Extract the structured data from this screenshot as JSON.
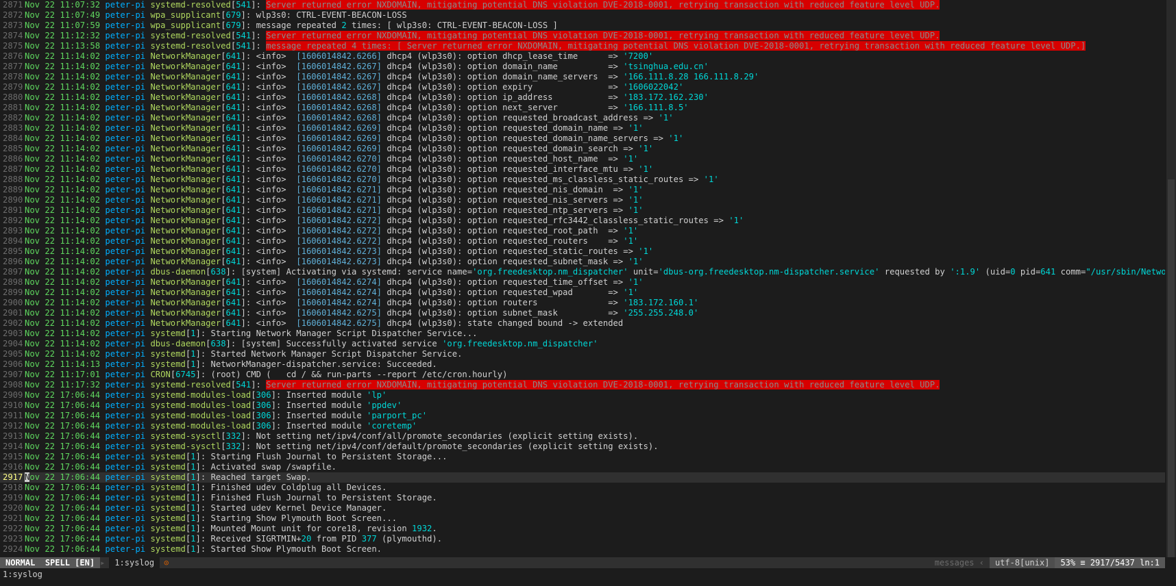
{
  "lines": [
    {
      "n": "2871",
      "ts": "Nov 22 11:07:32",
      "host": "peter-pi",
      "prog": "systemd-resolved",
      "pid": "541",
      "msg": "Server returned error NXDOMAIN, mitigating potential DNS violation DVE-2018-0001, retrying transaction with reduced feature level UDP.",
      "kind": "err"
    },
    {
      "n": "2872",
      "ts": "Nov 22 11:07:49",
      "host": "peter-pi",
      "prog": "wpa_supplicant",
      "pid": "679",
      "msg": "wlp3s0: CTRL-EVENT-BEACON-LOSS",
      "kind": "plain"
    },
    {
      "n": "2873",
      "ts": "Nov 22 11:07:59",
      "host": "peter-pi",
      "prog": "wpa_supplicant",
      "pid": "679",
      "pre": "message repeated ",
      "num": "2",
      "post": " times: [ wlp3s0: CTRL-EVENT-BEACON-LOSS ]",
      "kind": "repeat"
    },
    {
      "n": "2874",
      "ts": "Nov 22 11:12:32",
      "host": "peter-pi",
      "prog": "systemd-resolved",
      "pid": "541",
      "msg": "Server returned error NXDOMAIN, mitigating potential DNS violation DVE-2018-0001, retrying transaction with reduced feature level UDP.",
      "kind": "err"
    },
    {
      "n": "2875",
      "ts": "Nov 22 11:13:58",
      "host": "peter-pi",
      "prog": "systemd-resolved",
      "pid": "541",
      "msg": "message repeated 4 times: [ Server returned error NXDOMAIN, mitigating potential DNS violation DVE-2018-0001, retrying transaction with reduced feature level UDP.]",
      "kind": "err"
    },
    {
      "n": "2876",
      "ts": "Nov 22 11:14:02",
      "host": "peter-pi",
      "prog": "NetworkManager",
      "pid": "641",
      "stamp": "[1606014842.6266]",
      "opt": "dhcp4 (wlp3s0): option dhcp_lease_time      => ",
      "val": "'7200'",
      "kind": "nm"
    },
    {
      "n": "2877",
      "ts": "Nov 22 11:14:02",
      "host": "peter-pi",
      "prog": "NetworkManager",
      "pid": "641",
      "stamp": "[1606014842.6267]",
      "opt": "dhcp4 (wlp3s0): option domain_name          => ",
      "val": "'tsinghua.edu.cn'",
      "kind": "nm"
    },
    {
      "n": "2878",
      "ts": "Nov 22 11:14:02",
      "host": "peter-pi",
      "prog": "NetworkManager",
      "pid": "641",
      "stamp": "[1606014842.6267]",
      "opt": "dhcp4 (wlp3s0): option domain_name_servers  => ",
      "val": "'166.111.8.28 166.111.8.29'",
      "kind": "nm"
    },
    {
      "n": "2879",
      "ts": "Nov 22 11:14:02",
      "host": "peter-pi",
      "prog": "NetworkManager",
      "pid": "641",
      "stamp": "[1606014842.6267]",
      "opt": "dhcp4 (wlp3s0): option expiry               => ",
      "val": "'1606022042'",
      "kind": "nm"
    },
    {
      "n": "2880",
      "ts": "Nov 22 11:14:02",
      "host": "peter-pi",
      "prog": "NetworkManager",
      "pid": "641",
      "stamp": "[1606014842.6268]",
      "opt": "dhcp4 (wlp3s0): option ip_address           => ",
      "val": "'183.172.162.230'",
      "kind": "nm"
    },
    {
      "n": "2881",
      "ts": "Nov 22 11:14:02",
      "host": "peter-pi",
      "prog": "NetworkManager",
      "pid": "641",
      "stamp": "[1606014842.6268]",
      "opt": "dhcp4 (wlp3s0): option next_server          => ",
      "val": "'166.111.8.5'",
      "kind": "nm"
    },
    {
      "n": "2882",
      "ts": "Nov 22 11:14:02",
      "host": "peter-pi",
      "prog": "NetworkManager",
      "pid": "641",
      "stamp": "[1606014842.6268]",
      "opt": "dhcp4 (wlp3s0): option requested_broadcast_address => ",
      "val": "'1'",
      "kind": "nm"
    },
    {
      "n": "2883",
      "ts": "Nov 22 11:14:02",
      "host": "peter-pi",
      "prog": "NetworkManager",
      "pid": "641",
      "stamp": "[1606014842.6269]",
      "opt": "dhcp4 (wlp3s0): option requested_domain_name => ",
      "val": "'1'",
      "kind": "nm"
    },
    {
      "n": "2884",
      "ts": "Nov 22 11:14:02",
      "host": "peter-pi",
      "prog": "NetworkManager",
      "pid": "641",
      "stamp": "[1606014842.6269]",
      "opt": "dhcp4 (wlp3s0): option requested_domain_name_servers => ",
      "val": "'1'",
      "kind": "nm"
    },
    {
      "n": "2885",
      "ts": "Nov 22 11:14:02",
      "host": "peter-pi",
      "prog": "NetworkManager",
      "pid": "641",
      "stamp": "[1606014842.6269]",
      "opt": "dhcp4 (wlp3s0): option requested_domain_search => ",
      "val": "'1'",
      "kind": "nm"
    },
    {
      "n": "2886",
      "ts": "Nov 22 11:14:02",
      "host": "peter-pi",
      "prog": "NetworkManager",
      "pid": "641",
      "stamp": "[1606014842.6270]",
      "opt": "dhcp4 (wlp3s0): option requested_host_name  => ",
      "val": "'1'",
      "kind": "nm"
    },
    {
      "n": "2887",
      "ts": "Nov 22 11:14:02",
      "host": "peter-pi",
      "prog": "NetworkManager",
      "pid": "641",
      "stamp": "[1606014842.6270]",
      "opt": "dhcp4 (wlp3s0): option requested_interface_mtu => ",
      "val": "'1'",
      "kind": "nm"
    },
    {
      "n": "2888",
      "ts": "Nov 22 11:14:02",
      "host": "peter-pi",
      "prog": "NetworkManager",
      "pid": "641",
      "stamp": "[1606014842.6270]",
      "opt": "dhcp4 (wlp3s0): option requested_ms_classless_static_routes => ",
      "val": "'1'",
      "kind": "nm"
    },
    {
      "n": "2889",
      "ts": "Nov 22 11:14:02",
      "host": "peter-pi",
      "prog": "NetworkManager",
      "pid": "641",
      "stamp": "[1606014842.6271]",
      "opt": "dhcp4 (wlp3s0): option requested_nis_domain  => ",
      "val": "'1'",
      "kind": "nm"
    },
    {
      "n": "2890",
      "ts": "Nov 22 11:14:02",
      "host": "peter-pi",
      "prog": "NetworkManager",
      "pid": "641",
      "stamp": "[1606014842.6271]",
      "opt": "dhcp4 (wlp3s0): option requested_nis_servers => ",
      "val": "'1'",
      "kind": "nm"
    },
    {
      "n": "2891",
      "ts": "Nov 22 11:14:02",
      "host": "peter-pi",
      "prog": "NetworkManager",
      "pid": "641",
      "stamp": "[1606014842.6271]",
      "opt": "dhcp4 (wlp3s0): option requested_ntp_servers => ",
      "val": "'1'",
      "kind": "nm"
    },
    {
      "n": "2892",
      "ts": "Nov 22 11:14:02",
      "host": "peter-pi",
      "prog": "NetworkManager",
      "pid": "641",
      "stamp": "[1606014842.6272]",
      "opt": "dhcp4 (wlp3s0): option requested_rfc3442_classless_static_routes => ",
      "val": "'1'",
      "kind": "nm"
    },
    {
      "n": "2893",
      "ts": "Nov 22 11:14:02",
      "host": "peter-pi",
      "prog": "NetworkManager",
      "pid": "641",
      "stamp": "[1606014842.6272]",
      "opt": "dhcp4 (wlp3s0): option requested_root_path  => ",
      "val": "'1'",
      "kind": "nm"
    },
    {
      "n": "2894",
      "ts": "Nov 22 11:14:02",
      "host": "peter-pi",
      "prog": "NetworkManager",
      "pid": "641",
      "stamp": "[1606014842.6272]",
      "opt": "dhcp4 (wlp3s0): option requested_routers    => ",
      "val": "'1'",
      "kind": "nm"
    },
    {
      "n": "2895",
      "ts": "Nov 22 11:14:02",
      "host": "peter-pi",
      "prog": "NetworkManager",
      "pid": "641",
      "stamp": "[1606014842.6273]",
      "opt": "dhcp4 (wlp3s0): option requested_static_routes => ",
      "val": "'1'",
      "kind": "nm"
    },
    {
      "n": "2896",
      "ts": "Nov 22 11:14:02",
      "host": "peter-pi",
      "prog": "NetworkManager",
      "pid": "641",
      "stamp": "[1606014842.6273]",
      "opt": "dhcp4 (wlp3s0): option requested_subnet_mask => ",
      "val": "'1'",
      "kind": "nm"
    },
    {
      "n": "2897",
      "ts": "Nov 22 11:14:02",
      "host": "peter-pi",
      "prog": "dbus-daemon",
      "pid": "638",
      "kind": "dbus1",
      "a": "[system] Activating via systemd: service name=",
      "b": "'org.freedesktop.nm_dispatcher'",
      "c": " unit=",
      "d": "'dbus-org.freedesktop.nm-dispatcher.service'",
      "e": " requested by ",
      "f": "':1.9'",
      "g": " (uid=",
      "h": "0",
      "i": " pid=",
      "j": "641",
      "k": " comm=",
      "l": "\"/usr/sbin/NetworkManage#"
    },
    {
      "n": "2898",
      "ts": "Nov 22 11:14:02",
      "host": "peter-pi",
      "prog": "NetworkManager",
      "pid": "641",
      "stamp": "[1606014842.6274]",
      "opt": "dhcp4 (wlp3s0): option requested_time_offset => ",
      "val": "'1'",
      "kind": "nm"
    },
    {
      "n": "2899",
      "ts": "Nov 22 11:14:02",
      "host": "peter-pi",
      "prog": "NetworkManager",
      "pid": "641",
      "stamp": "[1606014842.6274]",
      "opt": "dhcp4 (wlp3s0): option requested_wpad       => ",
      "val": "'1'",
      "kind": "nm"
    },
    {
      "n": "2900",
      "ts": "Nov 22 11:14:02",
      "host": "peter-pi",
      "prog": "NetworkManager",
      "pid": "641",
      "stamp": "[1606014842.6274]",
      "opt": "dhcp4 (wlp3s0): option routers              => ",
      "val": "'183.172.160.1'",
      "kind": "nm"
    },
    {
      "n": "2901",
      "ts": "Nov 22 11:14:02",
      "host": "peter-pi",
      "prog": "NetworkManager",
      "pid": "641",
      "stamp": "[1606014842.6275]",
      "opt": "dhcp4 (wlp3s0): option subnet_mask          => ",
      "val": "'255.255.248.0'",
      "kind": "nm"
    },
    {
      "n": "2902",
      "ts": "Nov 22 11:14:02",
      "host": "peter-pi",
      "prog": "NetworkManager",
      "pid": "641",
      "stamp": "[1606014842.6275]",
      "opt": "dhcp4 (wlp3s0): state changed bound -> extended",
      "val": "",
      "kind": "nm"
    },
    {
      "n": "2903",
      "ts": "Nov 22 11:14:02",
      "host": "peter-pi",
      "prog": "systemd",
      "pid": "1",
      "msg": "Starting Network Manager Script Dispatcher Service...",
      "kind": "plain"
    },
    {
      "n": "2904",
      "ts": "Nov 22 11:14:02",
      "host": "peter-pi",
      "prog": "dbus-daemon",
      "pid": "638",
      "pre": "[system] Successfully activated service ",
      "str": "'org.freedesktop.nm_dispatcher'",
      "kind": "dbus2"
    },
    {
      "n": "2905",
      "ts": "Nov 22 11:14:02",
      "host": "peter-pi",
      "prog": "systemd",
      "pid": "1",
      "msg": "Started Network Manager Script Dispatcher Service.",
      "kind": "plain"
    },
    {
      "n": "2906",
      "ts": "Nov 22 11:14:13",
      "host": "peter-pi",
      "prog": "systemd",
      "pid": "1",
      "msg": "NetworkManager-dispatcher.service: Succeeded.",
      "kind": "plain"
    },
    {
      "n": "2907",
      "ts": "Nov 22 11:17:01",
      "host": "peter-pi",
      "prog": "CRON",
      "pid": "6745",
      "msg": "(root) CMD (   cd / && run-parts --report /etc/cron.hourly)",
      "kind": "plain"
    },
    {
      "n": "2908",
      "ts": "Nov 22 11:17:32",
      "host": "peter-pi",
      "prog": "systemd-resolved",
      "pid": "541",
      "msg": "Server returned error NXDOMAIN, mitigating potential DNS violation DVE-2018-0001, retrying transaction with reduced feature level UDP.",
      "kind": "err"
    },
    {
      "n": "2909",
      "ts": "Nov 22 17:06:44",
      "host": "peter-pi",
      "prog": "systemd-modules-load",
      "pid": "306",
      "pre": "Inserted module ",
      "str": "'lp'",
      "kind": "dbus2"
    },
    {
      "n": "2910",
      "ts": "Nov 22 17:06:44",
      "host": "peter-pi",
      "prog": "systemd-modules-load",
      "pid": "306",
      "pre": "Inserted module ",
      "str": "'ppdev'",
      "kind": "dbus2"
    },
    {
      "n": "2911",
      "ts": "Nov 22 17:06:44",
      "host": "peter-pi",
      "prog": "systemd-modules-load",
      "pid": "306",
      "pre": "Inserted module ",
      "str": "'parport_pc'",
      "kind": "dbus2"
    },
    {
      "n": "2912",
      "ts": "Nov 22 17:06:44",
      "host": "peter-pi",
      "prog": "systemd-modules-load",
      "pid": "306",
      "pre": "Inserted module ",
      "str": "'coretemp'",
      "kind": "dbus2"
    },
    {
      "n": "2913",
      "ts": "Nov 22 17:06:44",
      "host": "peter-pi",
      "prog": "systemd-sysctl",
      "pid": "332",
      "msg": "Not setting net/ipv4/conf/all/promote_secondaries (explicit setting exists).",
      "kind": "plain"
    },
    {
      "n": "2914",
      "ts": "Nov 22 17:06:44",
      "host": "peter-pi",
      "prog": "systemd-sysctl",
      "pid": "332",
      "msg": "Not setting net/ipv4/conf/default/promote_secondaries (explicit setting exists).",
      "kind": "plain"
    },
    {
      "n": "2915",
      "ts": "Nov 22 17:06:44",
      "host": "peter-pi",
      "prog": "systemd",
      "pid": "1",
      "msg": "Starting Flush Journal to Persistent Storage...",
      "kind": "plain"
    },
    {
      "n": "2916",
      "ts": "Nov 22 17:06:44",
      "host": "peter-pi",
      "prog": "systemd",
      "pid": "1",
      "msg": "Activated swap /swapfile.",
      "kind": "plain"
    },
    {
      "n": "2917",
      "ts": "Nov 22 17:06:44",
      "host": "peter-pi",
      "prog": "systemd",
      "pid": "1",
      "msg": "Reached target Swap.",
      "kind": "plain",
      "current": true
    },
    {
      "n": "2918",
      "ts": "Nov 22 17:06:44",
      "host": "peter-pi",
      "prog": "systemd",
      "pid": "1",
      "msg": "Finished udev Coldplug all Devices.",
      "kind": "plain"
    },
    {
      "n": "2919",
      "ts": "Nov 22 17:06:44",
      "host": "peter-pi",
      "prog": "systemd",
      "pid": "1",
      "msg": "Finished Flush Journal to Persistent Storage.",
      "kind": "plain"
    },
    {
      "n": "2920",
      "ts": "Nov 22 17:06:44",
      "host": "peter-pi",
      "prog": "systemd",
      "pid": "1",
      "msg": "Started udev Kernel Device Manager.",
      "kind": "plain"
    },
    {
      "n": "2921",
      "ts": "Nov 22 17:06:44",
      "host": "peter-pi",
      "prog": "systemd",
      "pid": "1",
      "msg": "Starting Show Plymouth Boot Screen...",
      "kind": "plain"
    },
    {
      "n": "2922",
      "ts": "Nov 22 17:06:44",
      "host": "peter-pi",
      "prog": "systemd",
      "pid": "1",
      "pre": "Mounted Mount unit for core18, revision ",
      "num": "1932",
      "post": ".",
      "kind": "repeat"
    },
    {
      "n": "2923",
      "ts": "Nov 22 17:06:44",
      "host": "peter-pi",
      "prog": "systemd",
      "pid": "1",
      "pre": "Received SIGRTMIN+",
      "num": "20",
      "post": " from PID ",
      "num2": "377",
      "post2": " (plymouthd).",
      "kind": "repeat"
    },
    {
      "n": "2924",
      "ts": "Nov 22 17:06:44",
      "host": "peter-pi",
      "prog": "systemd",
      "pid": "1",
      "msg": "Started Show Plymouth Boot Screen.",
      "kind": "plain"
    }
  ],
  "statusline": {
    "mode": "NORMAL",
    "spell": "SPELL [EN]",
    "buffer": "1:syslog",
    "modified_marker": "⊙",
    "messages": "messages",
    "encoding": "utf-8[unix]",
    "percent": "53%",
    "position": "2917/5437",
    "line_col": "ln:1"
  },
  "cmdline": "1:syslog",
  "colors": {
    "error_bg": "#d70000",
    "timestamp": "#5fd75f",
    "host": "#00afff",
    "program": "#afd75f"
  }
}
